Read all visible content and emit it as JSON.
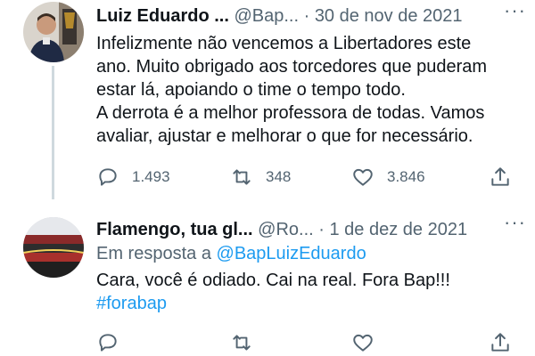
{
  "tweets": [
    {
      "name": "Luiz Eduardo ...",
      "handle": "@Bap...",
      "separator": "·",
      "date": "30 de nov de 2021",
      "more": "···",
      "lines": [
        "Infelizmente não vencemos a Libertadores este",
        "ano.  Muito obrigado aos torcedores que puderam",
        "estar lá, apoiando o time o tempo todo.",
        "A derrota é a melhor professora de todas. Vamos",
        "avaliar, ajustar e melhorar o que for necessário."
      ],
      "actions": {
        "replies": "1.493",
        "retweets": "348",
        "likes": "3.846"
      }
    },
    {
      "name": "Flamengo, tua gl...",
      "handle": "@Ro...",
      "separator": "·",
      "date": "1 de dez de 2021",
      "more": "···",
      "reply_prefix": "Em resposta a",
      "reply_mention": "@BapLuizEduardo",
      "text": "Cara, você é odiado.  Cai na real.  Fora Bap!!!",
      "hashtag": "#forabap",
      "actions": {
        "replies": "",
        "retweets": "",
        "likes": ""
      }
    }
  ],
  "colors": {
    "text": "#0f1419",
    "muted": "#536471",
    "link": "#1d9bf0",
    "thread_line": "#cfd9de"
  },
  "icons": [
    "reply-icon",
    "retweet-icon",
    "like-icon",
    "share-icon",
    "more-icon"
  ]
}
